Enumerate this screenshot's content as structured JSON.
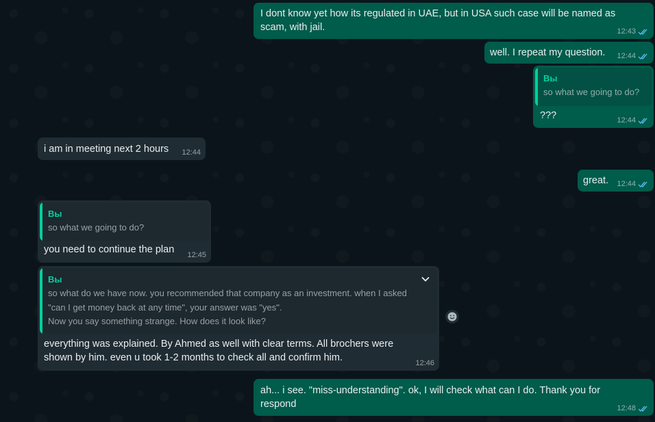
{
  "messages": [
    {
      "id": "m1",
      "direction": "out",
      "text": "I dont know yet how its regulated in UAE, but in USA such case will be named as scam, with jail.",
      "time": "12:43",
      "status": "read"
    },
    {
      "id": "m2",
      "direction": "out",
      "text": "well. I repeat my question.",
      "time": "12:44",
      "status": "read"
    },
    {
      "id": "m3",
      "direction": "out",
      "quote": {
        "author": "Вы",
        "text": "so what we going to do?"
      },
      "text": "???",
      "time": "12:44",
      "status": "read"
    },
    {
      "id": "m4",
      "direction": "in",
      "text": "i am in meeting next 2 hours",
      "time": "12:44"
    },
    {
      "id": "m5",
      "direction": "out",
      "text": "great.",
      "time": "12:44",
      "status": "read"
    },
    {
      "id": "m6",
      "direction": "in",
      "quote": {
        "author": "Вы",
        "text": "so what we going to do?"
      },
      "text": "you need to continue the plan",
      "time": "12:45"
    },
    {
      "id": "m7",
      "direction": "in",
      "quote": {
        "author": "Вы",
        "lines": [
          "so what do we have now. you recommended that company as an investment. when I asked",
          "\"can I get money back at any time\", your answer was \"yes\".",
          "Now you say something strange. How does it look like?"
        ]
      },
      "lines": [
        "everything was explained. By Ahmed as well with clear terms. All brochers were",
        "shown by him. even u took 1-2 months to check all and confirm him."
      ],
      "time": "12:46"
    },
    {
      "id": "m8",
      "direction": "out",
      "lines": [
        "ah... i see. \"miss-understanding\". ok, I will check what can I do. Thank you for",
        "respond"
      ],
      "time": "12:48",
      "status": "read"
    }
  ],
  "colors": {
    "outgoing": "#005c4b",
    "incoming": "#202c33",
    "background": "#0b141a",
    "quote_accent": "#06cf9c",
    "read_ticks": "#53bdeb"
  },
  "icons": {
    "read_receipt": "double-check-icon",
    "menu": "chevron-down-icon",
    "reaction": "emoji-icon"
  }
}
